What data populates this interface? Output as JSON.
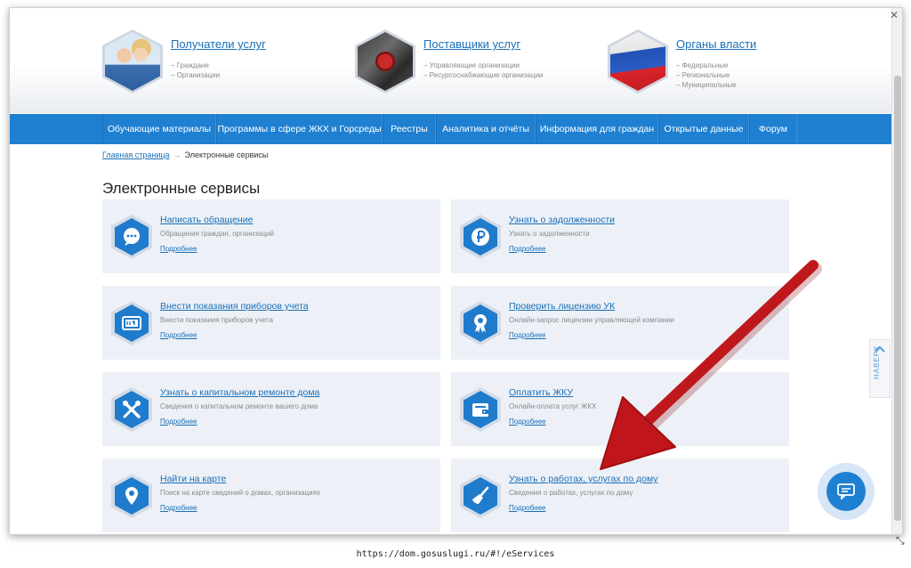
{
  "roles": [
    {
      "title": "Получатели услуг",
      "subs": [
        "– Граждане",
        "– Организации"
      ],
      "image": "people-photo"
    },
    {
      "title": "Поставщики услуг",
      "subs": [
        "– Управляющие организации",
        "– Ресурсоснабжающие организации"
      ],
      "image": "valve-photo"
    },
    {
      "title": "Органы власти",
      "subs": [
        "– Федеральные",
        "– Региональные",
        "– Муниципальные"
      ],
      "image": "russian-flag"
    }
  ],
  "nav": [
    "Обучающие материалы",
    "Программы в сфере ЖКХ и Горсреды",
    "Реестры",
    "Аналитика и отчёты",
    "Информация для граждан",
    "Открытые данные",
    "Форум"
  ],
  "breadcrumb": {
    "home": "Главная страница",
    "arrow": "→",
    "current": "Электронные сервисы"
  },
  "page_title": "Электронные сервисы",
  "more_label": "Подробнее",
  "cards": [
    {
      "title": "Написать обращение",
      "desc": "Обращения граждан, организаций",
      "icon": "chat-bubble-icon"
    },
    {
      "title": "Узнать о задолженности",
      "desc": "Узнать о задолженности",
      "icon": "ruble-icon"
    },
    {
      "title": "Внести показания приборов учета",
      "desc": "Внести показания приборов учета",
      "icon": "meter-icon"
    },
    {
      "title": "Проверить лицензию УК",
      "desc": "Онлайн-запрос лицензии управляющей компании",
      "icon": "license-badge-icon"
    },
    {
      "title": "Узнать о капитальном ремонте дома",
      "desc": "Сведения о капитальном ремонте вашего дома",
      "icon": "tools-icon"
    },
    {
      "title": "Оплатить ЖКУ",
      "desc": "Онлайн-оплата услуг ЖКХ",
      "icon": "wallet-icon"
    },
    {
      "title": "Найти на карте",
      "desc": "Поиск на карте сведений о домах, организациях",
      "icon": "map-pin-icon"
    },
    {
      "title": "Узнать о работах, услугах по дому",
      "desc": "Сведения о работах, услугах по дому",
      "icon": "broom-icon"
    }
  ],
  "to_top_label": "НАВЕРХ",
  "url": "https://dom.gosuslugi.ru/#!/eServices",
  "colors": {
    "primary": "#1f80d2",
    "link": "#1a6fb7",
    "card_bg": "#edf1f7",
    "arrow": "#c0161b"
  }
}
